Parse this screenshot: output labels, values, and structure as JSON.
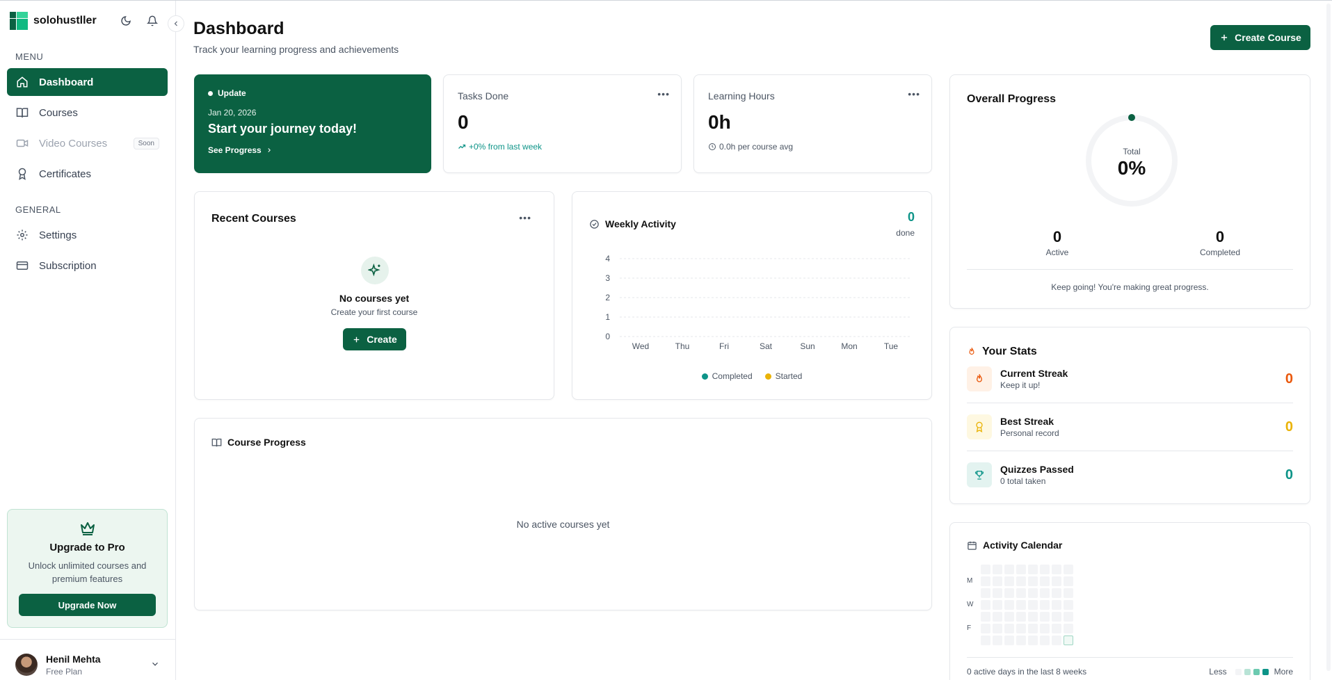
{
  "brand": {
    "name": "solohustller"
  },
  "sidebar": {
    "menu_label": "MENU",
    "general_label": "GENERAL",
    "items": [
      {
        "label": "Dashboard",
        "icon": "home-icon",
        "active": true
      },
      {
        "label": "Courses",
        "icon": "book-icon"
      },
      {
        "label": "Video Courses",
        "icon": "video-icon",
        "badge": "Soon",
        "disabled": true
      },
      {
        "label": "Certificates",
        "icon": "award-icon"
      }
    ],
    "general_items": [
      {
        "label": "Settings",
        "icon": "gear-icon"
      },
      {
        "label": "Subscription",
        "icon": "credit-card-icon"
      }
    ],
    "upgrade": {
      "title": "Upgrade to Pro",
      "desc": "Unlock unlimited courses and premium features",
      "button": "Upgrade Now"
    },
    "user": {
      "name": "Henil Mehta",
      "plan": "Free Plan"
    }
  },
  "header": {
    "title": "Dashboard",
    "subtitle": "Track your learning progress and achievements",
    "create_button": "Create Course"
  },
  "update_card": {
    "badge": "Update",
    "date": "Jan 20, 2026",
    "title": "Start your journey today!",
    "link": "See Progress"
  },
  "tasks_card": {
    "label": "Tasks Done",
    "value": "0",
    "foot": "+0% from last week"
  },
  "hours_card": {
    "label": "Learning Hours",
    "value": "0h",
    "foot": "0.0h per course avg"
  },
  "recent_courses": {
    "title": "Recent Courses",
    "empty_title": "No courses yet",
    "empty_sub": "Create your first course",
    "create_button": "Create"
  },
  "weekly_activity": {
    "title": "Weekly Activity",
    "count": "0",
    "count_label": "done",
    "legend": [
      "Completed",
      "Started"
    ]
  },
  "chart_data": {
    "type": "bar",
    "categories": [
      "Wed",
      "Thu",
      "Fri",
      "Sat",
      "Sun",
      "Mon",
      "Tue"
    ],
    "series": [
      {
        "name": "Completed",
        "values": [
          0,
          0,
          0,
          0,
          0,
          0,
          0
        ]
      },
      {
        "name": "Started",
        "values": [
          0,
          0,
          0,
          0,
          0,
          0,
          0
        ]
      }
    ],
    "y_ticks": [
      "0",
      "1",
      "2",
      "3",
      "4"
    ],
    "ylim": [
      0,
      4
    ],
    "colors": {
      "Completed": "#0d9488",
      "Started": "#eab308"
    },
    "grid": true
  },
  "course_progress": {
    "title": "Course Progress",
    "empty": "No active courses yet"
  },
  "overall_progress": {
    "title": "Overall Progress",
    "ring_label": "Total",
    "percent_text": "0%",
    "percent": 0,
    "active_value": "0",
    "active_label": "Active",
    "completed_value": "0",
    "completed_label": "Completed",
    "message": "Keep going! You're making great progress."
  },
  "your_stats": {
    "title": "Your Stats",
    "rows": [
      {
        "title": "Current Streak",
        "sub": "Keep it up!",
        "value": "0",
        "color": "#ea580c",
        "bg": "#fff1e6",
        "icon": "flame-icon"
      },
      {
        "title": "Best Streak",
        "sub": "Personal record",
        "value": "0",
        "color": "#eab308",
        "bg": "#fef8e1",
        "icon": "award-icon"
      },
      {
        "title": "Quizzes Passed",
        "sub": "0 total taken",
        "value": "0",
        "color": "#0d9488",
        "bg": "#e3f3f0",
        "icon": "trophy-icon"
      }
    ]
  },
  "activity_calendar": {
    "title": "Activity Calendar",
    "day_labels": [
      "M",
      "W",
      "F"
    ],
    "footer": "0 active days in the last 8 weeks",
    "legend_less": "Less",
    "legend_more": "More"
  },
  "colors": {
    "brand": "#0b6142",
    "accent": "#0d9488"
  }
}
